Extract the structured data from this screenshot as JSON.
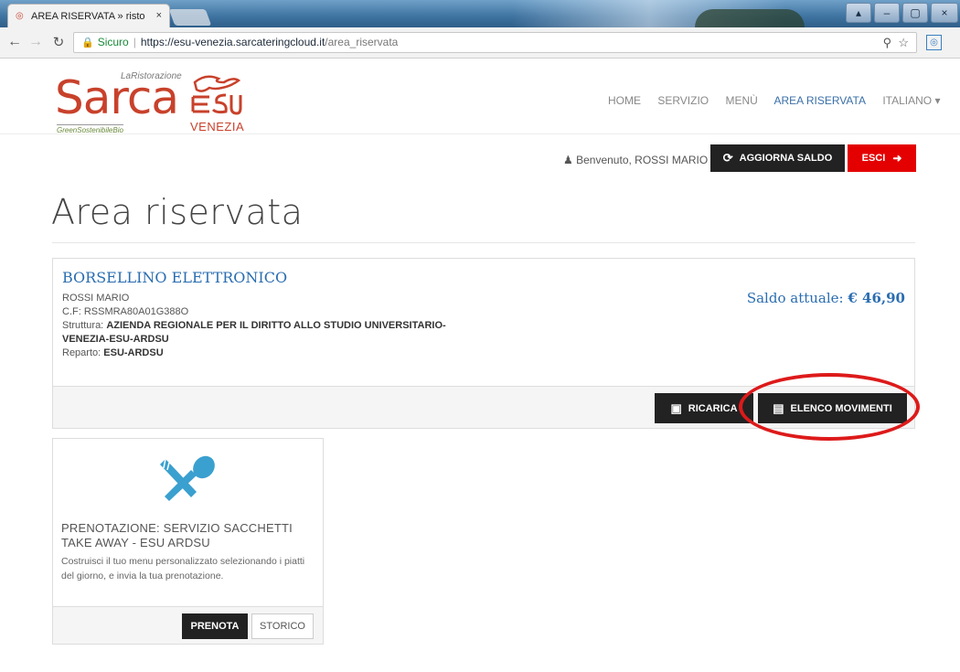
{
  "browser": {
    "tab_title": "AREA RISERVATA » risto",
    "tab_close": "×",
    "secure_label": "Sicuro",
    "url_host": "https://esu-venezia.sarcateringcloud.it",
    "url_path": "/area_riservata",
    "win_controls": [
      "▴",
      "–",
      "▢",
      "×"
    ]
  },
  "logo": {
    "brand": "Sarca",
    "subtitle": "LaRistorazione",
    "tagline": "GreenSostenibileBio",
    "city": "VENEZIA"
  },
  "nav": {
    "items": [
      "HOME",
      "SERVIZIO",
      "MENÙ",
      "AREA RISERVATA",
      "ITALIANO ▾"
    ],
    "active": "AREA RISERVATA"
  },
  "userbar": {
    "welcome": "Benvenuto, ROSSI MARIO",
    "refresh_label": "AGGIORNA SALDO",
    "logout_label": "ESCI"
  },
  "page": {
    "title": "Area riservata"
  },
  "wallet": {
    "title": "BORSELLINO ELETTRONICO",
    "name": "ROSSI MARIO",
    "cf": "C.F: RSSMRA80A01G388O",
    "struttura_label": "Struttura:",
    "struttura_value_1": "AZIENDA REGIONALE PER IL DIRITTO ALLO STUDIO UNIVERSITARIO-",
    "struttura_value_2": "VENEZIA-ESU-ARDSU",
    "reparto_label": "Reparto:",
    "reparto_value": "ESU-ARDSU",
    "saldo_label": "Saldo attuale:",
    "saldo_value": "€ 46,90",
    "ricarica_label": "RICARICA",
    "movimenti_label": "ELENCO MOVIMENTI"
  },
  "service_card": {
    "title": "PRENOTAZIONE: SERVIZIO SACCHETTI TAKE AWAY - ESU ARDSU",
    "description": "Costruisci il tuo menu personalizzato selezionando i piatti del giorno, e invia la tua prenotazione.",
    "prenota_label": "PRENOTA",
    "storico_label": "STORICO"
  },
  "colors": {
    "brand_red": "#c8412b",
    "link_blue": "#2a6db0",
    "dark_button": "#222222",
    "logout_red": "#e40000",
    "icon_blue": "#3aa0cf",
    "annotation_red": "#dd1a1a"
  }
}
